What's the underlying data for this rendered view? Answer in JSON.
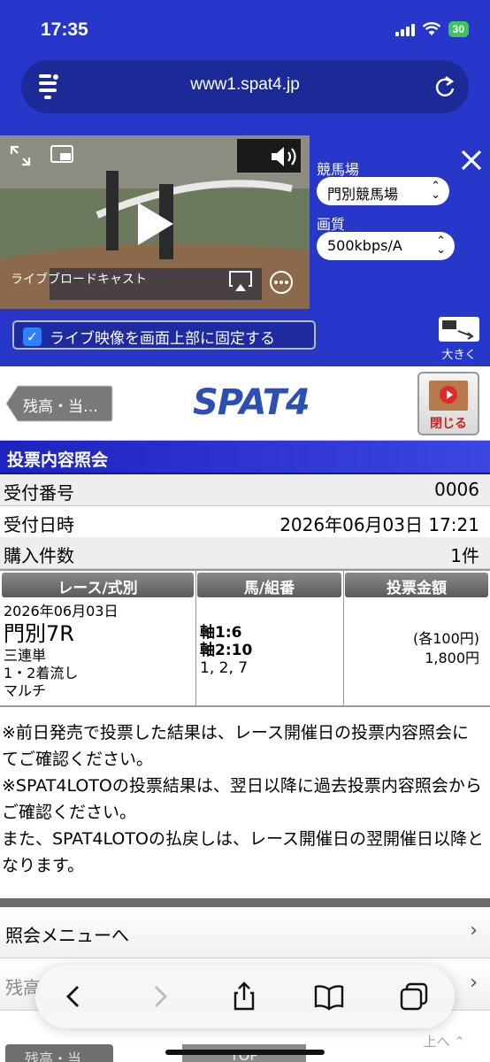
{
  "status_bar": {
    "time": "17:35",
    "battery": "30"
  },
  "browser": {
    "url": "www1.spat4.jp"
  },
  "video": {
    "caption": "ライブブロードキャスト",
    "track_label": "競馬場",
    "track_value": "門別競馬場",
    "quality_label": "画質",
    "quality_value": "500kbps/A",
    "fix_label": "ライブ映像を画面上部に固定する",
    "bigger_label": "大きく"
  },
  "header": {
    "back_label": "残高・当…",
    "logo": "SPAT4",
    "close_video_label": "閉じる"
  },
  "section": {
    "title": "投票内容照会",
    "rows": [
      {
        "key": "受付番号",
        "value": "0006"
      },
      {
        "key": "受付日時",
        "value": "2026年06月03日 17:21"
      },
      {
        "key": "購入件数",
        "value": "1件"
      }
    ]
  },
  "table": {
    "headers": [
      "レース/式別",
      "馬/組番",
      "投票金額"
    ],
    "race_date": "2026年06月03日",
    "race_name": "門別7R",
    "bet_type": "三連単",
    "bet_method": "1・2着流し",
    "bet_option": "マルチ",
    "axis1": "軸1:6",
    "axis2": "軸2:10",
    "partners": "1, 2, 7",
    "unit_amount": "(各100円)",
    "total_amount": "1,800円"
  },
  "notes": [
    "※前日発売で投票した結果は、レース開催日の投票内容照会にてご確認ください。",
    "※SPAT4LOTOの投票結果は、翌日以降に過去投票内容照会からご確認ください。",
    "また、SPAT4LOTOの払戻しは、レース開催日の翌開催日以降となります。"
  ],
  "menu": {
    "item1": "照会メニューへ",
    "item2": "残高"
  },
  "bottom": {
    "back_label": "残高・当…",
    "top_label": "TOP",
    "up_label": "上へ"
  }
}
